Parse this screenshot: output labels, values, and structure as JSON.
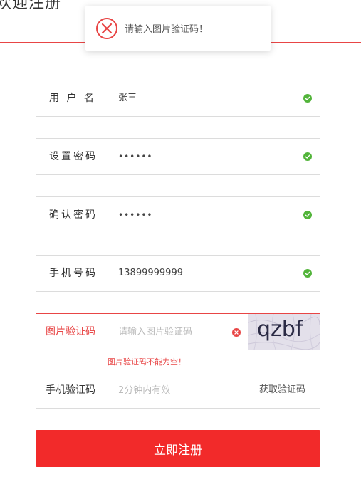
{
  "header": {
    "title": "欢迎注册"
  },
  "toast": {
    "icon": "error-circle-icon",
    "message": "请输入图片验证码！"
  },
  "form": {
    "username": {
      "label": "用 户 名",
      "value": "张三",
      "status": "valid"
    },
    "password": {
      "label": "设置密码",
      "value": "••••••",
      "status": "valid"
    },
    "confirm_password": {
      "label": "确认密码",
      "value": "••••••",
      "status": "valid"
    },
    "phone": {
      "label": "手机号码",
      "value": "13899999999",
      "status": "valid"
    },
    "image_captcha": {
      "label": "图片验证码",
      "placeholder": "请输入图片验证码",
      "value": "",
      "captcha_text": "qzbf",
      "error": "图片验证码不能为空！"
    },
    "sms_code": {
      "label": "手机验证码",
      "placeholder": "2分钟内有效",
      "value": "",
      "button_label": "获取验证码"
    },
    "submit_label": "立即注册"
  },
  "colors": {
    "accent": "#f22a2a",
    "error": "#e84545",
    "valid": "#52b43a"
  }
}
